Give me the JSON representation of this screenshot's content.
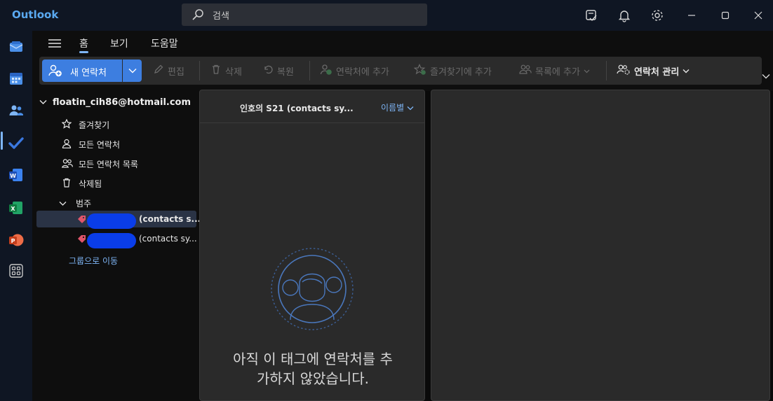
{
  "app": {
    "title": "Outlook"
  },
  "search": {
    "placeholder": "검색"
  },
  "tabs": [
    {
      "label": "홈",
      "active": true
    },
    {
      "label": "보기",
      "active": false
    },
    {
      "label": "도움말",
      "active": false
    }
  ],
  "ribbon": {
    "new_contact": "새 연락처",
    "edit": "편집",
    "delete": "삭제",
    "restore": "복원",
    "add_to_contacts": "연락처에 추가",
    "add_to_favorites": "즐겨찾기에 추가",
    "add_to_list": "목록에 추가",
    "manage_contacts": "연락처 관리"
  },
  "folders": {
    "account": "floatin_cih86@hotmail.com",
    "items": [
      {
        "label": "즐겨찾기",
        "icon": "star-icon"
      },
      {
        "label": "모든 연락처",
        "icon": "person-icon"
      },
      {
        "label": "모든 연락처 목록",
        "icon": "people-icon"
      },
      {
        "label": "삭제됨",
        "icon": "trash-icon"
      }
    ],
    "categories_label": "범주",
    "categories": [
      {
        "label": "(contacts s...",
        "selected": true
      },
      {
        "label": "(contacts sy...",
        "selected": false
      }
    ],
    "goto_groups": "그룹으로 이동"
  },
  "list": {
    "title": "인호의 S21 (contacts sy...",
    "sort": "이름별",
    "empty_line1": "아직 이 태그에 연락처를 추",
    "empty_line2": "가하지 않았습니다."
  },
  "colors": {
    "accent": "#3d7ee0",
    "link": "#7eb5f5",
    "tag": "#e0556a"
  }
}
